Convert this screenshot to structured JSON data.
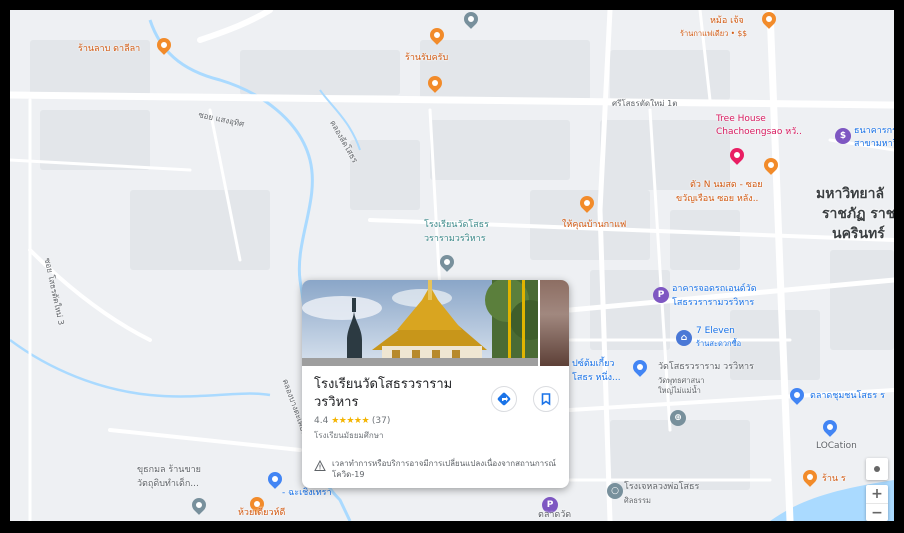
{
  "map": {
    "place_labels": {
      "tl_shop": "ร้านลาบ ดาลีลา",
      "tl_shop2": "ร้านรับครับ",
      "tr_shop": "หม้อ เจ้จ",
      "tr_shop_sub": "ร้านกาแฟเดียว • $$",
      "tree_house": "Tree House",
      "tree_house2": "Chachoengsao หวั..",
      "right_place": "ธนาคารกร",
      "right_place2": "สาขามหาวิ",
      "nearby_shop": "ตัว N นมสด - ซอย",
      "nearby_shop2": "ขวัญเรือน ซอย หลัง..",
      "university1": "มหาวิทยาลั",
      "university2": "ราชภัฏ ราช",
      "university3": "นครินทร์",
      "school_label1": "โรงเรียนวัดโสธร",
      "school_label2": "วรารามวรวิหาร",
      "cafe_label": "ให้คุณบ้านกาแฟ",
      "building1": "อาคารจอดรถเอนด์วัด",
      "building2": "โสธรวรารามวรวิหาร",
      "seven_eleven": "7 Eleven",
      "seven_eleven_sub": "ร้านสะดวกซื้อ",
      "temple1": "วัดโสธรวราราม วรวิหาร",
      "temple_sub1": "วัดพุทธศาสนา",
      "temple_sub2": "ใหญ่ไม่แม่น้ำ",
      "left_mid1": "ปซ์ต้มเกี้ยว",
      "left_mid2": "โสธร หนึ่ง...",
      "market": "ตลาดชุมชนโสธร ร",
      "location": "LOCation",
      "shrine": "โรงเจหลวงพ่อโสธร",
      "shrine_sub": "ศิลธรรม",
      "bottom_left1": "ขุธกมล ร้านขาย",
      "bottom_left2": "วัตถุดิบทำเด็ก...",
      "bottom_left3": "ห้วยเดียวห์ดี",
      "bottom_mid": "- ฉะเชิงเทรา",
      "bottom_market": "ตลาดวัด",
      "river_shop": "ร้าน ร"
    },
    "road_labels": {
      "r1": "ศรีโสธรตัดใหม่ 1ต",
      "r2": "ซอย แสงอุทิศ",
      "r3": "คลองลัดโสธร",
      "r4": "ซอย โสธรตัดใหม่ 3",
      "r5": "คลองบางตะเคียน"
    }
  },
  "place_card": {
    "title": "โรงเรียนวัดโสธรวราราม วรวิหาร",
    "rating": "4.4",
    "stars": "★★★★★",
    "review_count": "(37)",
    "place_type": "โรงเรียนมัธยมศึกษา",
    "notice": "เวลาทำการหรือบริการอาจมีการเปลี่ยนแปลงเนื่องจากสถานการณ์โควิด-19"
  },
  "controls": {
    "zoom_in": "+",
    "zoom_out": "−"
  },
  "colors": {
    "water": "#aadaff",
    "road": "#ffffff",
    "land": "#eef0f3",
    "block": "#e3e6ea",
    "poi_orange": "#f28b2a",
    "poi_blue": "#4285f4",
    "accent": "#1a73e8"
  },
  "icons": {
    "directions": "directions-icon",
    "save": "bookmark-icon",
    "warning": "warning-icon",
    "location": "my-location-icon"
  }
}
